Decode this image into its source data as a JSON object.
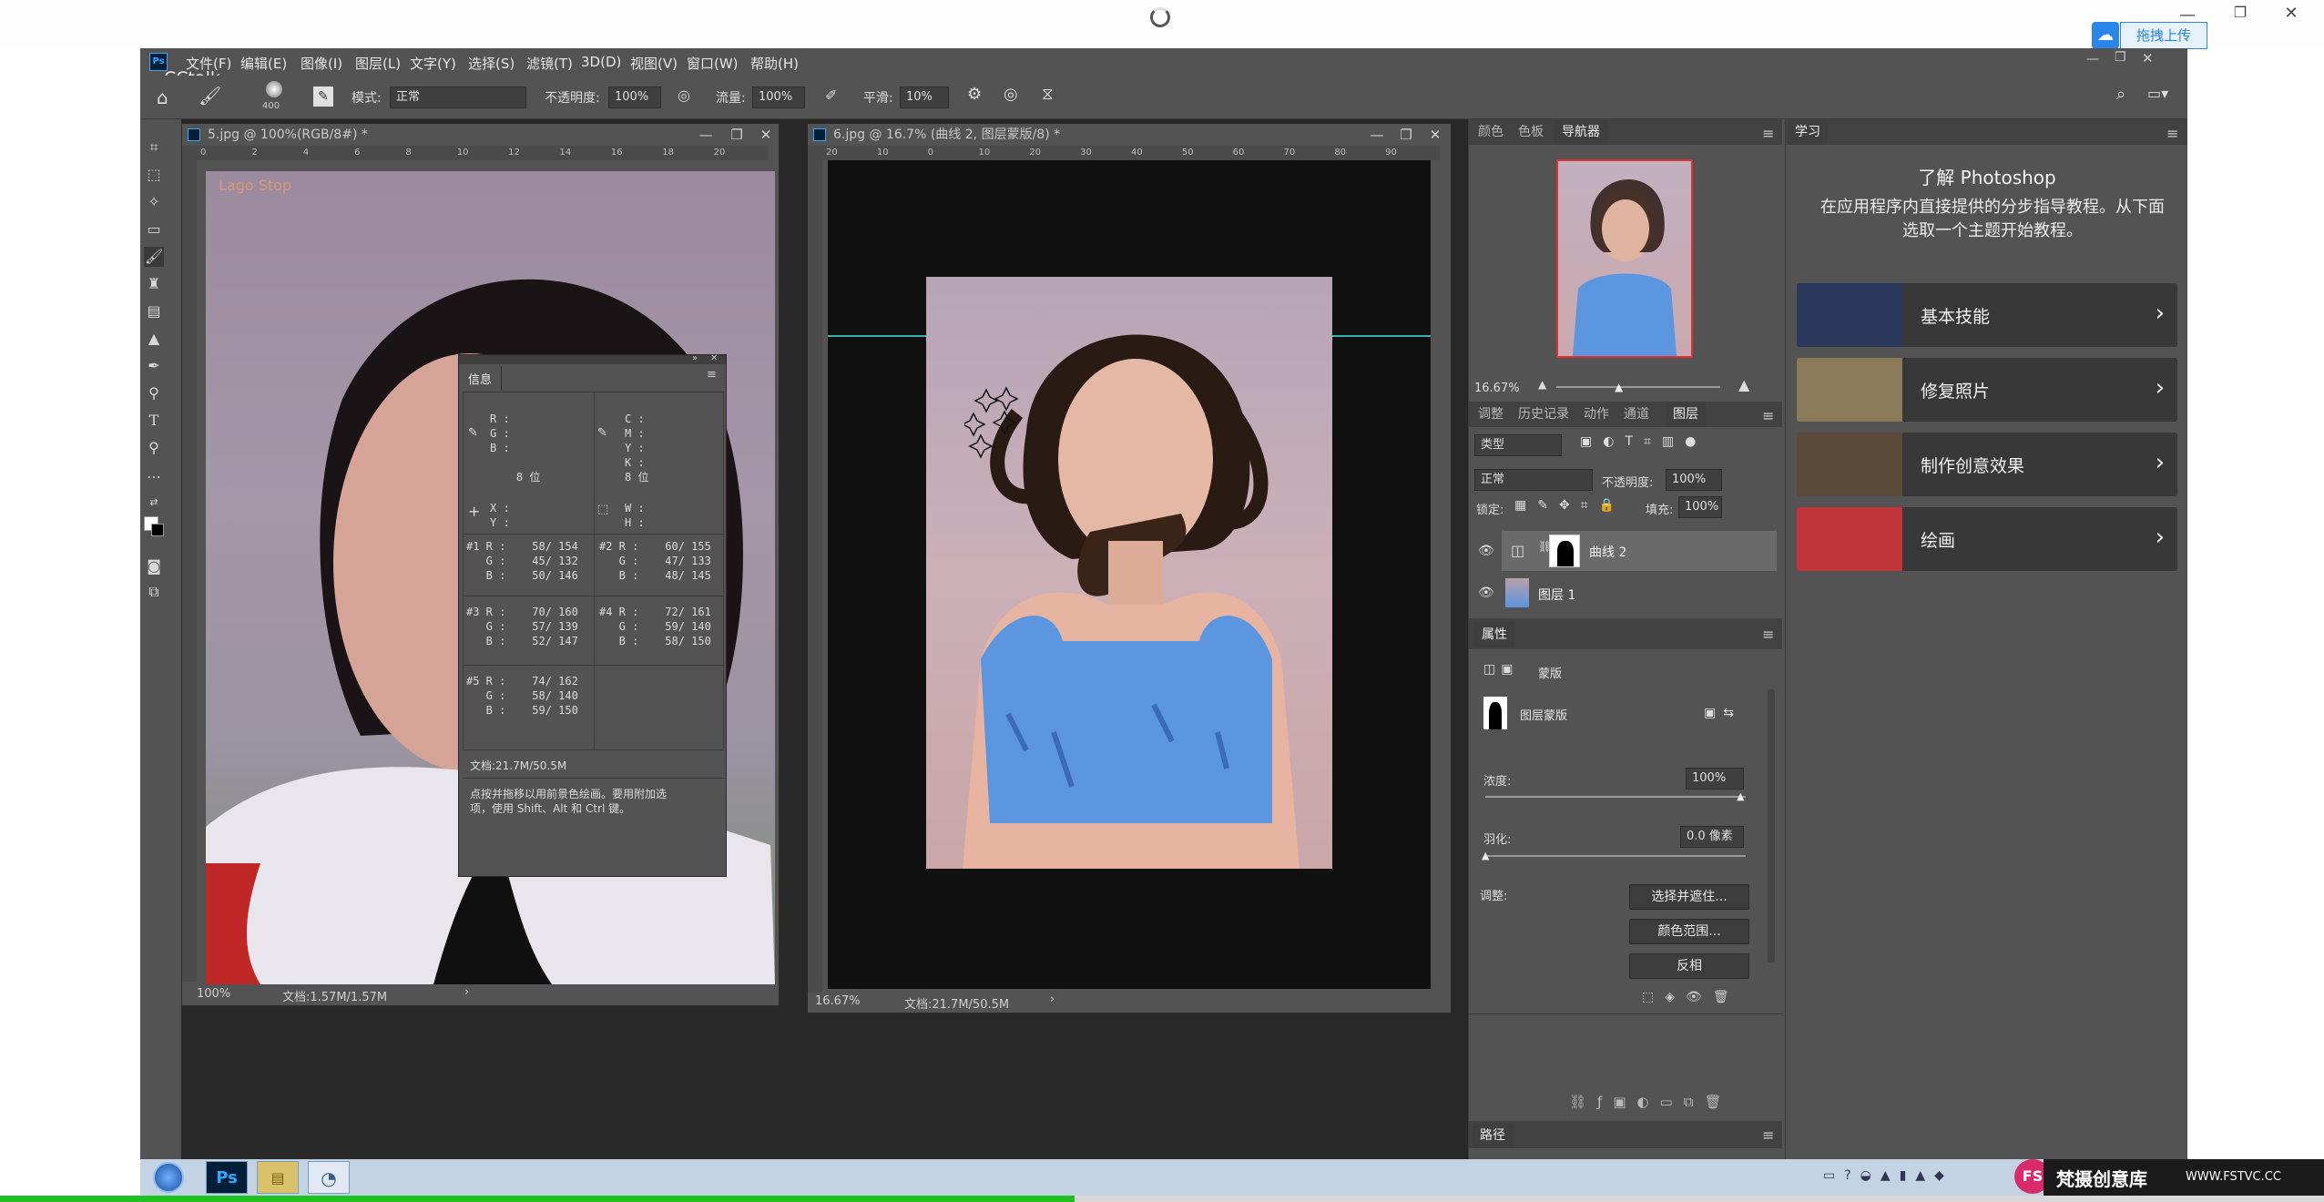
{
  "outer": {
    "upload_label": "拖拽上传",
    "min_icon": "minimize-icon",
    "restore_icon": "restore-icon",
    "close_icon": "close-icon"
  },
  "overlay_text": "CCtalk",
  "menu": [
    "文件(F)",
    "编辑(E)",
    "图像(I)",
    "图层(L)",
    "文字(Y)",
    "选择(S)",
    "滤镜(T)",
    "3D(D)",
    "视图(V)",
    "窗口(W)",
    "帮助(H)"
  ],
  "options": {
    "brush_size": "400",
    "mode_label": "模式:",
    "mode_value": "正常",
    "opacity_label": "不透明度:",
    "opacity_value": "100%",
    "flow_label": "流量:",
    "flow_value": "100%",
    "smooth_label": "平滑:",
    "smooth_value": "10%"
  },
  "doc1": {
    "title": "5.jpg @ 100%(RGB/8#) *",
    "zoom": "100%",
    "docsize": "文档:1.57M/1.57M",
    "watermark": "Lago Stop",
    "ruler_marks": [
      "0",
      "2",
      "4",
      "6",
      "8",
      "10",
      "12",
      "14",
      "16",
      "18",
      "20"
    ]
  },
  "doc2": {
    "title": "6.jpg @ 16.7% (曲线 2, 图层蒙版/8) *",
    "zoom": "16.67%",
    "docsize": "文档:21.7M/50.5M",
    "ruler_marks": [
      "20",
      "10",
      "0",
      "10",
      "20",
      "30",
      "40",
      "50",
      "60",
      "70",
      "80",
      "90"
    ]
  },
  "info_panel": {
    "title": "信息",
    "rgb_block": "R :\nG :\nB :\n\n    8 位",
    "cmyk_block": "C :\nM :\nY :\nK :\n8 位",
    "xy_block": "X :\nY :",
    "wh_block": "W :\nH :",
    "s1": "#1 R :    58/ 154\n   G :    45/ 132\n   B :    50/ 146",
    "s2": "#2 R :    60/ 155\n   G :    47/ 133\n   B :    48/ 145",
    "s3": "#3 R :    70/ 160\n   G :    57/ 139\n   B :    52/ 147",
    "s4": "#4 R :    72/ 161\n   G :    59/ 140\n   B :    58/ 150",
    "s5": "#5 R :    74/ 162\n   G :    58/ 140\n   B :    59/ 150",
    "doc": "文档:21.7M/50.5M",
    "hint": "点按并拖移以用前景色绘画。要用附加选\n项，使用 Shift、Alt 和 Ctrl 键。"
  },
  "nav_tabs": [
    "颜色",
    "色板",
    "导航器"
  ],
  "nav_zoom": "16.67%",
  "layer_tabs": [
    "调整",
    "历史记录",
    "动作",
    "通道",
    "图层"
  ],
  "layers": {
    "kind": "类型",
    "blend": "正常",
    "opacity_label": "不透明度:",
    "opacity": "100%",
    "lock_label": "锁定:",
    "fill_label": "填充:",
    "fill": "100%",
    "items": [
      {
        "name": "曲线 2"
      },
      {
        "name": "图层 1"
      }
    ]
  },
  "props": {
    "title": "属性",
    "mask_tab": "蒙版",
    "type": "图层蒙版",
    "density_label": "浓度:",
    "density": "100%",
    "density_level": 1.0,
    "feather_label": "羽化:",
    "feather": "0.0 像素",
    "feather_level": 0.0,
    "adjust_label": "调整:",
    "btn1": "选择并遮住...",
    "btn2": "颜色范围...",
    "btn3": "反相"
  },
  "paths_tab": "路径",
  "learn": {
    "tab": "学习",
    "heading": "了解 Photoshop",
    "desc": "在应用程序内直接提供的分步指导教程。从下面\n选取一个主题开始教程。",
    "cards": [
      {
        "label": "基本技能",
        "color": "#2b3a5c"
      },
      {
        "label": "修复照片",
        "color": "#8a7a5a"
      },
      {
        "label": "制作创意效果",
        "color": "#5a4a3a"
      },
      {
        "label": "绘画",
        "color": "#c0343a"
      }
    ]
  },
  "watermark_brand": "梵摄创意库",
  "watermark_url": "WWW.FSTVC.CC"
}
